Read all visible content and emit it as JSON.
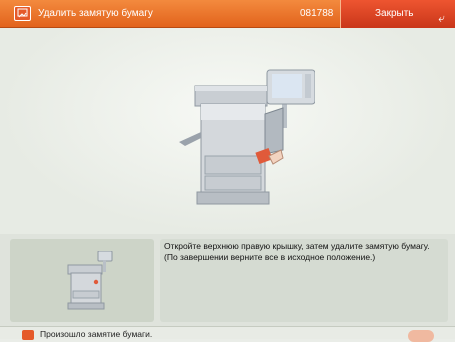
{
  "header": {
    "title": "Удалить замятую бумагу",
    "job_id": "081788",
    "close_label": "Закрыть",
    "close_arrow": "⤶",
    "icon": "paper-jam-icon"
  },
  "instructions": {
    "text": "Откройте верхнюю правую крышку, затем удалите замятую бумагу. (По завершении верните все в исходное положение.)"
  },
  "status": {
    "text": "Произошло замятие бумаги.",
    "icon": "paper-jam-icon"
  },
  "colors": {
    "title_bar": "#e8722b",
    "close_button": "#db4525",
    "background": "#eaede8"
  }
}
